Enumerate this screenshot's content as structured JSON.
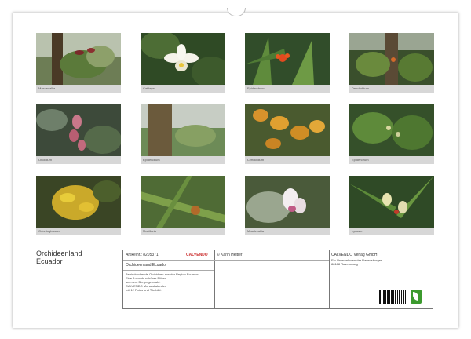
{
  "calendar": {
    "title_line1": "Orchideenland",
    "title_line2": "Ecuador",
    "months": [
      {
        "caption": "Masdevallia"
      },
      {
        "caption": "Cattleya"
      },
      {
        "caption": "Epidendrum"
      },
      {
        "caption": "Dendrobium"
      },
      {
        "caption": "Oncidium"
      },
      {
        "caption": "Epidendrum"
      },
      {
        "caption": "Cyrtochilum"
      },
      {
        "caption": "Epidendrum"
      },
      {
        "caption": "Odontoglossum"
      },
      {
        "caption": "Maxillaria"
      },
      {
        "caption": "Masdevallia"
      },
      {
        "caption": "Lycaste"
      }
    ]
  },
  "info": {
    "code_label": "Artikelnr.: 8205371",
    "logo_text": "CALVENDO",
    "product_title": "Orchideenland Ecuador",
    "description_lines": [
      "Beeindruckende Orchideen aus der Region Ecuador.",
      "Eine Auswahl schöner Blüten",
      "aus dem Bergregenwald.",
      "CALVENDO Monatskalender",
      "mit 12 Fotos und Titelbild."
    ],
    "credit": "© Karin Heitler",
    "publisher_lines": [
      "CALVENDO Verlag GmbH",
      "Ein Unternehmen der Ravensburger",
      "88188 Ravensburg"
    ]
  },
  "colors": {
    "caption_strip": "#d7d7d7",
    "eco_badge": "#3c9a2e"
  }
}
